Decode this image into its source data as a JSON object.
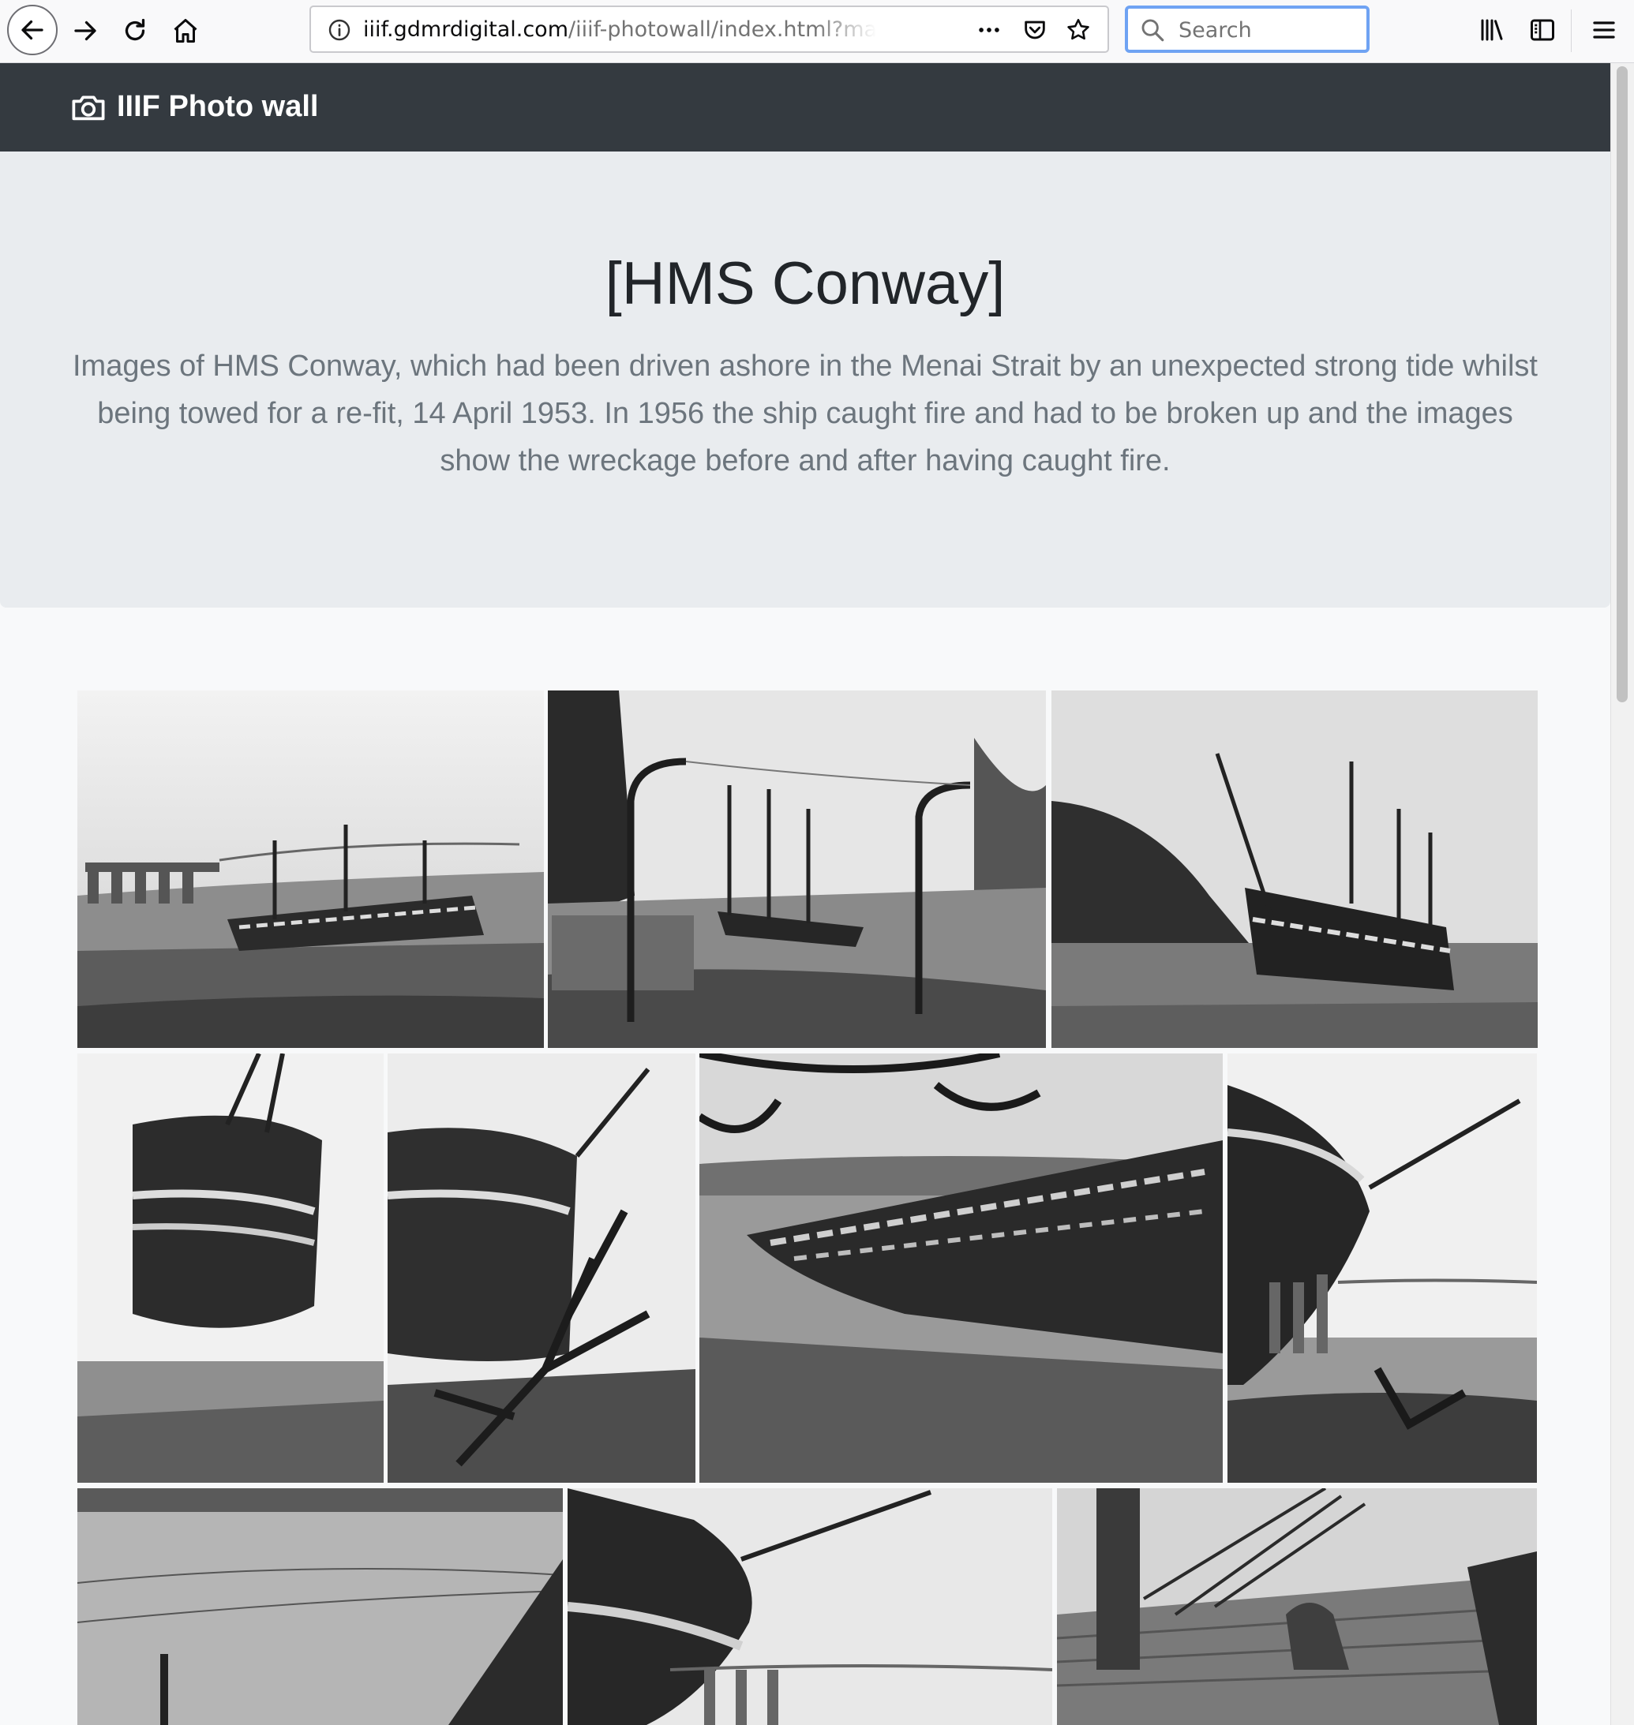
{
  "browser": {
    "url_domain": "iiif.gdmrdigital.com",
    "url_path": "/iiif-photowall/index.html?manifest=h",
    "search_placeholder": "Search"
  },
  "navbar": {
    "brand": "IIIF Photo wall"
  },
  "jumbotron": {
    "title": "[HMS Conway]",
    "lead": "Images of HMS Conway, which had been driven ashore in the Menai Strait by an unexpected strong tide whilst being towed for a re-fit, 14 April 1953. In 1956 the ship caught fire and had to be broken up and the images show the wreckage before and after having caught fire."
  },
  "colors": {
    "navbar_bg": "#343a40",
    "jumbotron_bg": "#e9ecef",
    "page_bg": "#f8f9fa",
    "search_focus": "#6fa3f3"
  }
}
